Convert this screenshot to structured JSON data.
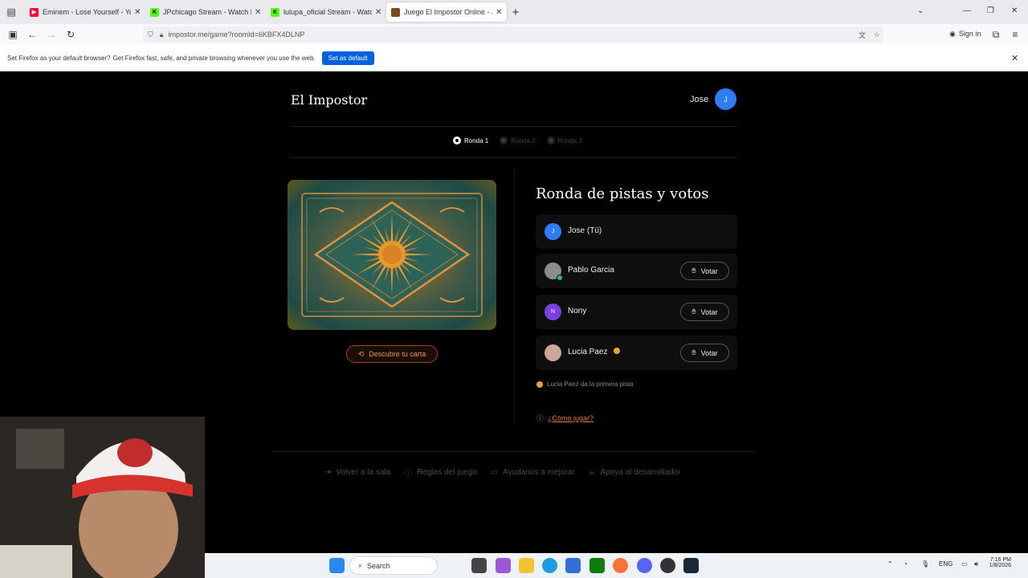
{
  "browser": {
    "tabs": [
      {
        "title": "Eminem - Lose Yourself - YouTube",
        "favicon": "youtube-icon",
        "color": "#ff0033"
      },
      {
        "title": "JPchicago Stream - Watch Live on Kick",
        "favicon": "kick-icon",
        "color": "#53fc18"
      },
      {
        "title": "lulupa_oficial Stream - Watch Live on Kick",
        "favicon": "kick-icon",
        "color": "#53fc18"
      },
      {
        "title": "Juego El Impostor Online - Juga",
        "favicon": "impostor-icon",
        "color": "#7a4a1a"
      }
    ],
    "url": "impostor.me/game?roomId=6KBFX4DLNP",
    "sign_in": "Sign in",
    "notification": {
      "bold": "Set Firefox as your default browser?",
      "text": "Get Firefox fast, safe, and private browsing whenever you use the web.",
      "button": "Set as default"
    }
  },
  "app": {
    "brand": "El Impostor",
    "user": {
      "name": "Jose",
      "initial": "J",
      "avatar_color": "#2f7df6"
    },
    "rounds": [
      {
        "label": "Ronda 1",
        "active": true
      },
      {
        "label": "Ronda 2",
        "active": false
      },
      {
        "label": "Ronda 3",
        "active": false
      }
    ],
    "reveal_button": "Descubre tu carta",
    "section_title": "Ronda de pistas y votos",
    "players": [
      {
        "name": "Jose (Tú)",
        "initial": "J",
        "color": "#2f7df6",
        "vote": ""
      },
      {
        "name": "Pablo Garcia",
        "initial": "",
        "color": "#8a8a8a",
        "vote": "Votar"
      },
      {
        "name": "Nony",
        "initial": "N",
        "color": "#7b3fe4",
        "vote": "Votar"
      },
      {
        "name": "Lucia Paez",
        "initial": "",
        "color": "#c9a79a",
        "vote": "Votar"
      }
    ],
    "hint": "Lucia Paez da la primera pista",
    "howto": "¿Cómo jugar?",
    "footer": [
      {
        "label": "Volver a la sala",
        "icon": "exit-icon"
      },
      {
        "label": "Reglas del juego",
        "icon": "info-icon"
      },
      {
        "label": "Ayudanos a mejorar",
        "icon": "chat-icon"
      },
      {
        "label": "Apoya al desarrollador",
        "icon": "coffee-icon"
      }
    ]
  },
  "taskbar": {
    "search": "Search",
    "lang": "ENG",
    "time": "7:16 PM",
    "date": "1/8/2026"
  },
  "colors": {
    "accent": "#e8793a",
    "blue": "#2f7df6",
    "gold": "#e6a52e"
  }
}
